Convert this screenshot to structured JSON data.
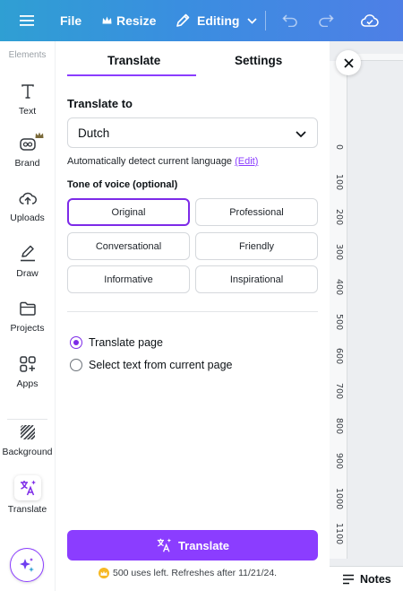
{
  "topbar": {
    "file_label": "File",
    "resize_label": "Resize",
    "editing_label": "Editing"
  },
  "rail": {
    "faded_label": "Elements",
    "items": [
      {
        "label": "Text",
        "icon": "text-icon"
      },
      {
        "label": "Brand",
        "icon": "brand-icon"
      },
      {
        "label": "Uploads",
        "icon": "uploads-icon"
      },
      {
        "label": "Draw",
        "icon": "draw-icon"
      },
      {
        "label": "Projects",
        "icon": "projects-icon"
      },
      {
        "label": "Apps",
        "icon": "apps-icon"
      },
      {
        "label": "Background",
        "icon": "background-icon"
      },
      {
        "label": "Translate",
        "icon": "translate-icon"
      }
    ]
  },
  "panel": {
    "tabs": [
      {
        "label": "Translate",
        "active": true
      },
      {
        "label": "Settings",
        "active": false
      }
    ],
    "translate_to_label": "Translate to",
    "language_value": "Dutch",
    "detect_text": "Automatically detect current language",
    "detect_link": "(Edit)",
    "tone_label": "Tone of voice (optional)",
    "tones": [
      "Original",
      "Professional",
      "Conversational",
      "Friendly",
      "Informative",
      "Inspirational"
    ],
    "selected_tone": "Original",
    "radios": [
      {
        "label": "Translate page",
        "checked": true
      },
      {
        "label": "Select text from current page",
        "checked": false
      }
    ],
    "translate_button": "Translate",
    "uses_text": "500 uses left. Refreshes after 11/21/24."
  },
  "canvas": {
    "ruler_ticks": [
      "0",
      "100",
      "200",
      "300",
      "400",
      "500",
      "600",
      "700",
      "800",
      "900",
      "1000",
      "1100"
    ],
    "notes_label": "Notes"
  },
  "colors": {
    "accent": "#8b3dff",
    "topbar_start": "#2f9fd3",
    "topbar_end": "#4e7fe6"
  }
}
